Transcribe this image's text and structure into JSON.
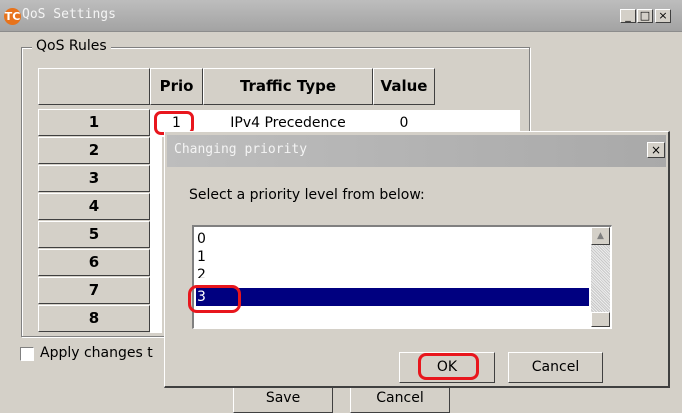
{
  "window": {
    "title": "QoS Settings",
    "logo": "TC",
    "minimize": "_",
    "maximize": "□",
    "close": "×"
  },
  "group_label": "QoS Rules",
  "table": {
    "headers": [
      "Prio",
      "Traffic Type",
      "Value"
    ],
    "row_numbers": [
      "1",
      "2",
      "3",
      "4",
      "5",
      "6",
      "7",
      "8"
    ],
    "row1": {
      "prio": "1",
      "traffic_type": "IPv4 Precedence",
      "value": "0"
    }
  },
  "apply_label": "Apply changes t",
  "buttons": {
    "save": "Save",
    "cancel": "Cancel"
  },
  "dialog": {
    "title": "Changing priority",
    "close": "×",
    "prompt": "Select a priority level from below:",
    "options": [
      "0",
      "1",
      "2",
      "3"
    ],
    "selected": "3",
    "ok": "OK",
    "cancel": "Cancel",
    "scroll_up": "▲"
  },
  "colors": {
    "selection": "#000080",
    "highlight_ring": "#e8161d",
    "face": "#d4d0c8"
  }
}
